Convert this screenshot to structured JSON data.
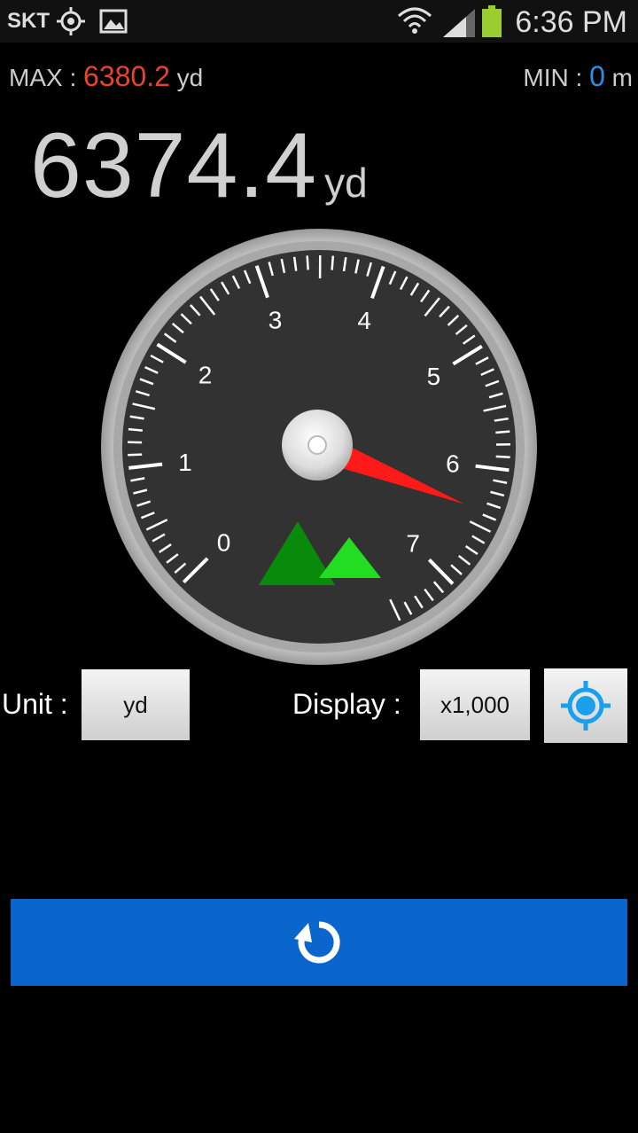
{
  "status_bar": {
    "carrier": "SKT",
    "time": "6:36 PM",
    "icons": [
      "gps-icon",
      "image-icon",
      "wifi-icon",
      "signal-icon",
      "battery-icon"
    ]
  },
  "readings": {
    "max_label": "MAX : ",
    "max_value": "6380.2",
    "max_unit": "yd",
    "min_label": "MIN : ",
    "min_value": "0",
    "min_unit": "m",
    "current_value": "6374.4",
    "current_unit": "yd"
  },
  "gauge": {
    "labels": [
      "0",
      "1",
      "2",
      "3",
      "4",
      "5",
      "6",
      "7"
    ],
    "needle_value": 6.3744,
    "range": [
      0,
      7.5
    ]
  },
  "controls": {
    "unit_label": "Unit : ",
    "unit_value": "yd",
    "display_label": "Display : ",
    "display_value": "x1,000"
  },
  "colors": {
    "max": "#e8442c",
    "min": "#2b8fe8",
    "needle": "#ff1a1a",
    "reset_bar": "#0a66cc",
    "locate_icon": "#1aa0ea"
  }
}
